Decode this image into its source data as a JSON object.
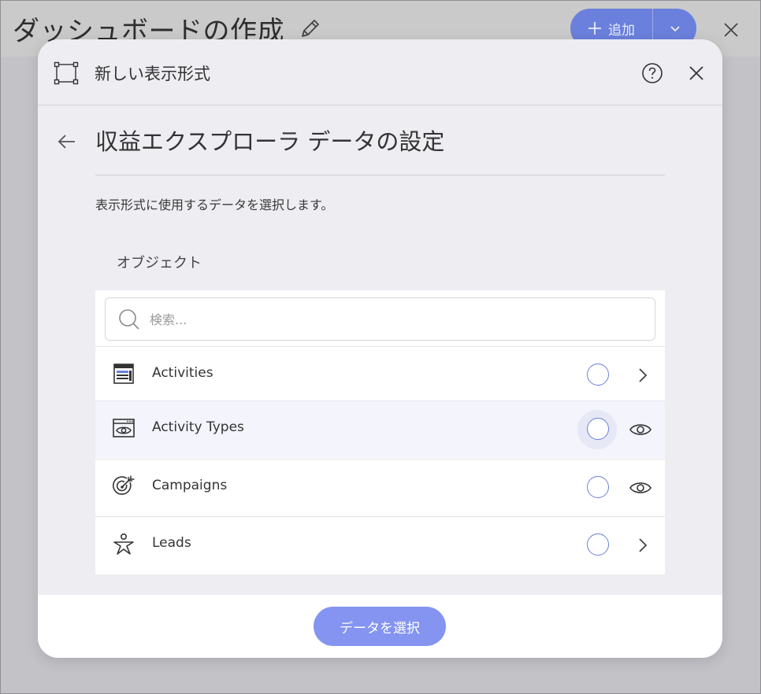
{
  "background": {
    "title": "ダッシュボードの作成",
    "add_label": "追加",
    "pencil_icon": "pencil-icon",
    "plus_icon": "plus-icon",
    "chevron_icon": "chevron-down-icon",
    "close_icon": "close-icon"
  },
  "modal": {
    "header_title": "新しい表示形式",
    "header_icon": "visualization-frame-icon",
    "help_icon": "help-icon",
    "close_icon": "close-icon",
    "back_icon": "arrow-left-icon",
    "page_title": "収益エクスプローラ データの設定",
    "description": "表示形式に使用するデータを選択します。",
    "section_label": "オブジェクト",
    "search": {
      "placeholder": "検索...",
      "value": ""
    },
    "items": [
      {
        "label": "Activities",
        "icon": "table-icon",
        "action": "chevron-right-icon",
        "selected": false
      },
      {
        "label": "Activity Types",
        "icon": "view-window-icon",
        "action": "eye-icon",
        "selected": false,
        "hovered": true
      },
      {
        "label": "Campaigns",
        "icon": "target-icon",
        "action": "eye-icon",
        "selected": false
      },
      {
        "label": "Leads",
        "icon": "person-star-icon",
        "action": "chevron-right-icon",
        "selected": false
      }
    ],
    "select_button": "データを選択"
  },
  "colors": {
    "accent": "#6b80dc",
    "button": "#8494f0",
    "modal_bg": "#ededf2",
    "backdrop": "#c2c2c7"
  }
}
